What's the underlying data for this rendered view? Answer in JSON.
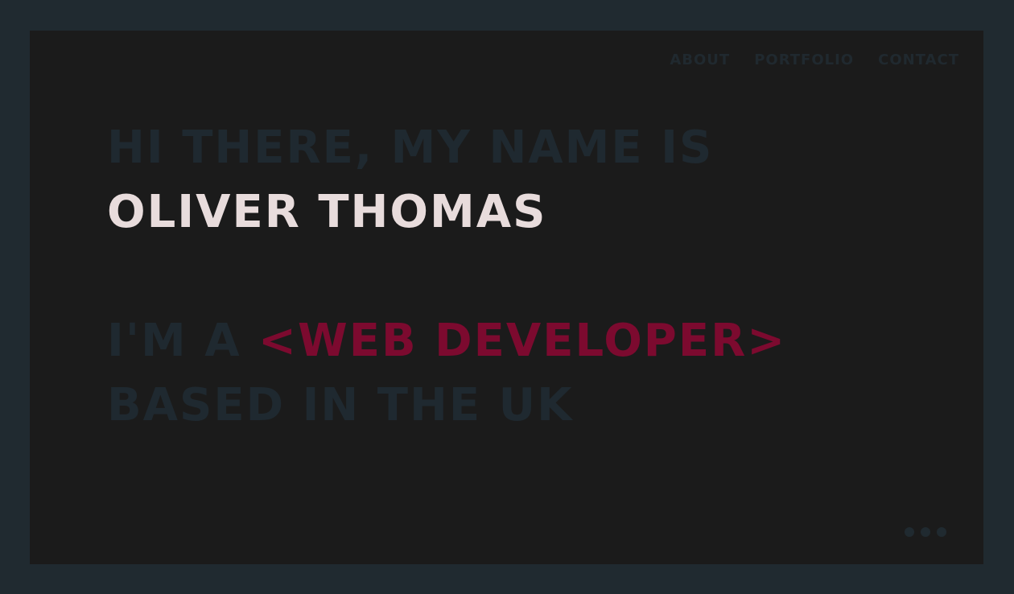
{
  "nav": {
    "items": [
      {
        "label": "ABOUT"
      },
      {
        "label": "PORTFOLIO"
      },
      {
        "label": "CONTACT"
      }
    ]
  },
  "hero": {
    "greeting": "HI THERE, MY NAME IS",
    "name": "OLIVER THOMAS",
    "role_prefix": "I'M A ",
    "role": "<WEB DEVELOPER>",
    "location": "BASED IN THE UK"
  },
  "menu": {
    "icon": "more-dots-icon"
  },
  "colors": {
    "outer_background": "#202a30",
    "panel_background": "#1b1b1b",
    "muted_text": "#1f2930",
    "name_text": "#e8dcdc",
    "accent": "#7c0a2f"
  }
}
